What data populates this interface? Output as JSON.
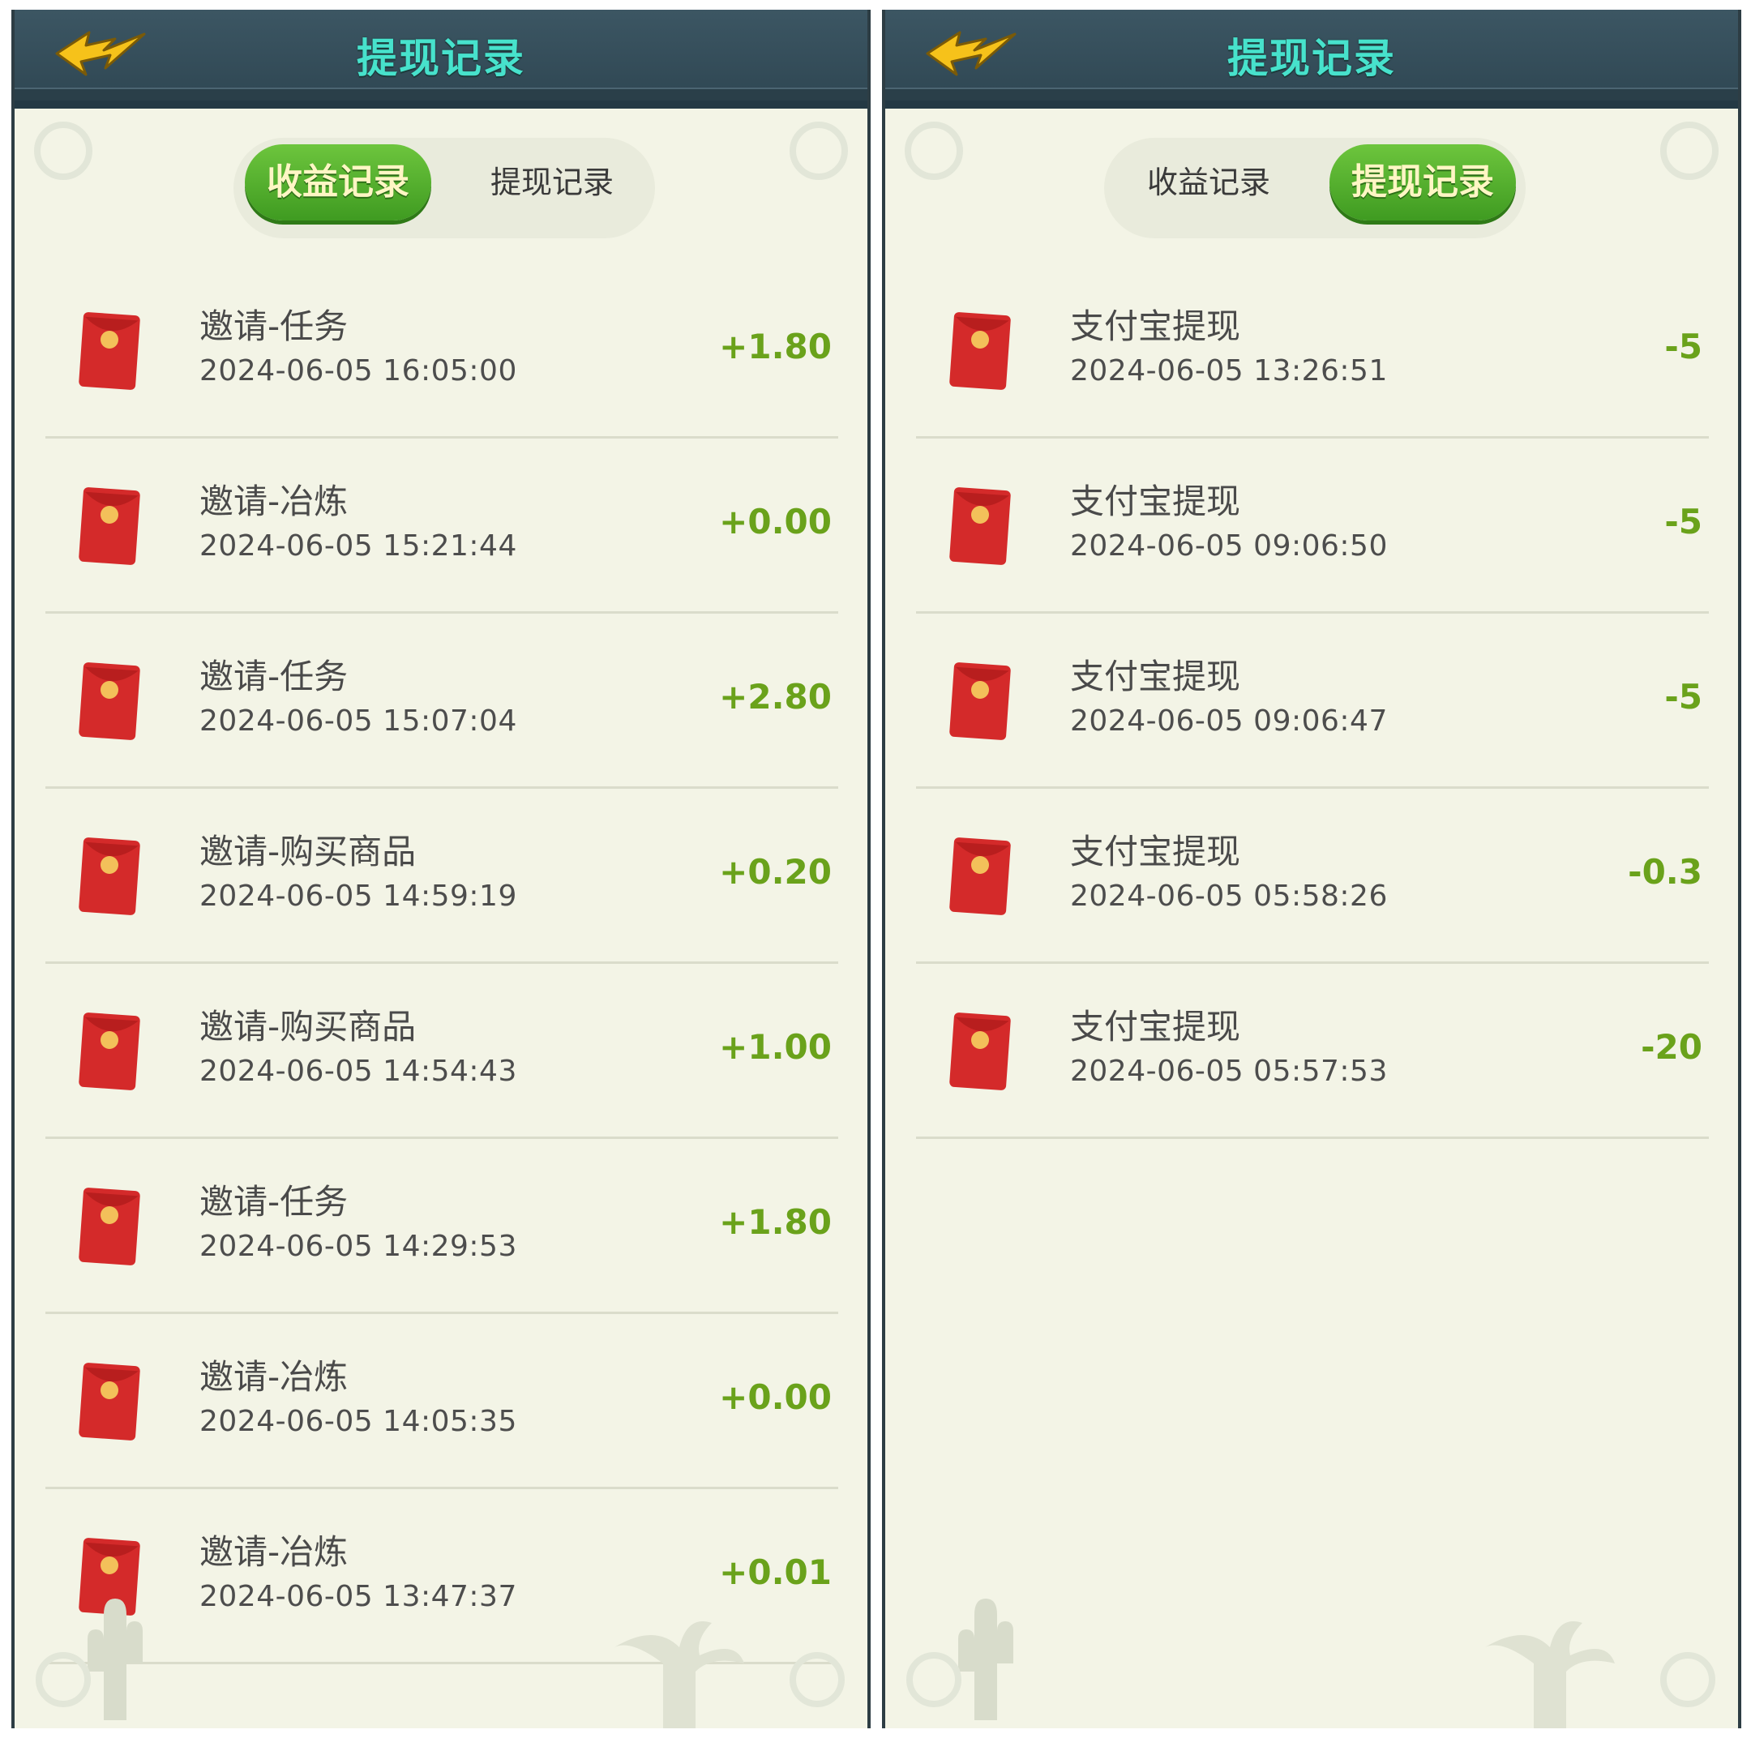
{
  "screens": [
    {
      "header": {
        "title": "提现记录",
        "back_icon": "lightning-arrow-back-icon"
      },
      "tabs": [
        {
          "label": "收益记录",
          "active": true
        },
        {
          "label": "提现记录",
          "active": false
        }
      ],
      "records": [
        {
          "title": "邀请-任务",
          "time": "2024-06-05 16:05:00",
          "amount": "+1.80"
        },
        {
          "title": "邀请-冶炼",
          "time": "2024-06-05 15:21:44",
          "amount": "+0.00"
        },
        {
          "title": "邀请-任务",
          "time": "2024-06-05 15:07:04",
          "amount": "+2.80"
        },
        {
          "title": "邀请-购买商品",
          "time": "2024-06-05 14:59:19",
          "amount": "+0.20"
        },
        {
          "title": "邀请-购买商品",
          "time": "2024-06-05 14:54:43",
          "amount": "+1.00"
        },
        {
          "title": "邀请-任务",
          "time": "2024-06-05 14:29:53",
          "amount": "+1.80"
        },
        {
          "title": "邀请-冶炼",
          "time": "2024-06-05 14:05:35",
          "amount": "+0.00"
        },
        {
          "title": "邀请-冶炼",
          "time": "2024-06-05 13:47:37",
          "amount": "+0.01"
        }
      ]
    },
    {
      "header": {
        "title": "提现记录",
        "back_icon": "lightning-arrow-back-icon"
      },
      "tabs": [
        {
          "label": "收益记录",
          "active": false
        },
        {
          "label": "提现记录",
          "active": true
        }
      ],
      "records": [
        {
          "title": "支付宝提现",
          "time": "2024-06-05 13:26:51",
          "amount": "-5"
        },
        {
          "title": "支付宝提现",
          "time": "2024-06-05 09:06:50",
          "amount": "-5"
        },
        {
          "title": "支付宝提现",
          "time": "2024-06-05 09:06:47",
          "amount": "-5"
        },
        {
          "title": "支付宝提现",
          "time": "2024-06-05 05:58:26",
          "amount": "-0.3"
        },
        {
          "title": "支付宝提现",
          "time": "2024-06-05 05:57:53",
          "amount": "-20"
        }
      ]
    }
  ],
  "colors": {
    "header_bg": "#2f4753",
    "title_text": "#47e2cc",
    "panel_bg": "#f3f4e6",
    "tab_active": "#4fa82a",
    "amount_text": "#6aa21b",
    "envelope_red": "#d42a2a"
  }
}
